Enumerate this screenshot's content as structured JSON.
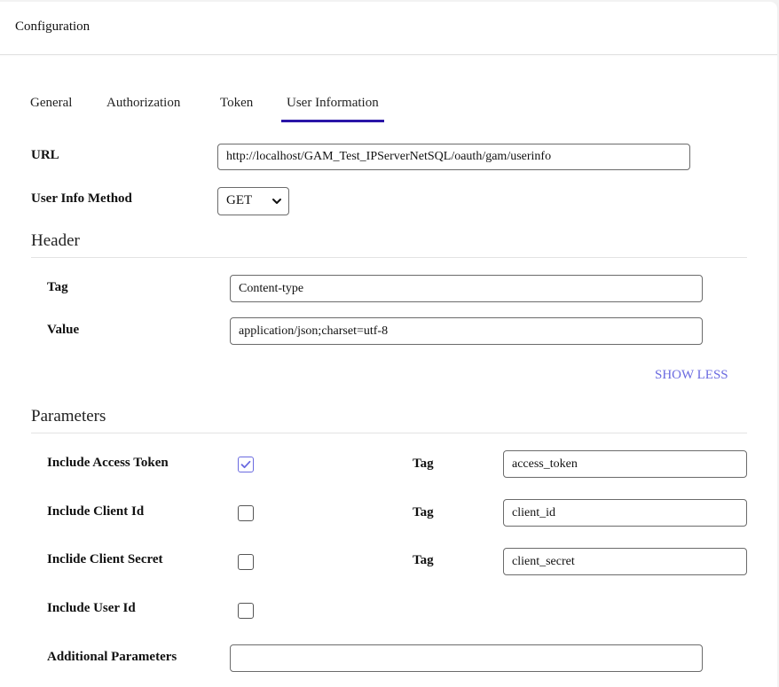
{
  "header": {
    "title": "Configuration"
  },
  "tabs": [
    {
      "label": "General",
      "active": false
    },
    {
      "label": "Authorization",
      "active": false
    },
    {
      "label": "Token",
      "active": false
    },
    {
      "label": "User Information",
      "active": true
    }
  ],
  "form": {
    "url": {
      "label": "URL",
      "value": "http://localhost/GAM_Test_IPServerNetSQL/oauth/gam/userinfo"
    },
    "method": {
      "label": "User Info Method",
      "selected": "GET"
    }
  },
  "header_section": {
    "title": "Header",
    "tag": {
      "label": "Tag",
      "value": "Content-type"
    },
    "value": {
      "label": "Value",
      "value": "application/json;charset=utf-8"
    },
    "show_less_label": "SHOW LESS"
  },
  "parameters_section": {
    "title": "Parameters",
    "rows": [
      {
        "label": "Include Access Token",
        "checked": true,
        "tag_label": "Tag",
        "tag_value": "access_token"
      },
      {
        "label": "Include Client Id",
        "checked": false,
        "tag_label": "Tag",
        "tag_value": "client_id"
      },
      {
        "label": "Inclide Client Secret",
        "checked": false,
        "tag_label": "Tag",
        "tag_value": "client_secret"
      },
      {
        "label": "Include User Id",
        "checked": false
      }
    ],
    "additional": {
      "label": "Additional Parameters",
      "value": ""
    }
  },
  "colors": {
    "accent": "#2b16a8",
    "link": "#6a6ae0",
    "checkbox_checked": "#6a6ae0"
  }
}
